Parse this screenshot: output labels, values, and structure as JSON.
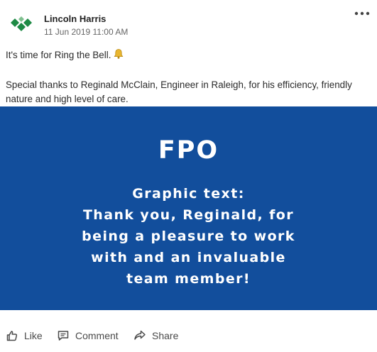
{
  "post": {
    "author": "Lincoln Harris",
    "timestamp": "11 Jun 2019 11:00 AM",
    "line1": "It's time for Ring the Bell.",
    "line2": "Special thanks to Reginald McClain, Engineer in Raleigh, for his efficiency, friendly nature and high level of care."
  },
  "graphic": {
    "title": "FPO",
    "lines": [
      "Graphic text:",
      "Thank you, Reginald, for",
      "being a pleasure to work",
      "with and an invaluable",
      "team member!"
    ],
    "background_color": "#124e9c",
    "text_color": "#ffffff"
  },
  "actions": {
    "like": "Like",
    "comment": "Comment",
    "share": "Share"
  },
  "icons": {
    "avatar": "green-diamond-logo",
    "more": "more-dots-icon",
    "bell": "bell-emoji-icon",
    "like": "thumbs-up-icon",
    "comment": "comment-icon",
    "share": "share-arrow-icon"
  }
}
